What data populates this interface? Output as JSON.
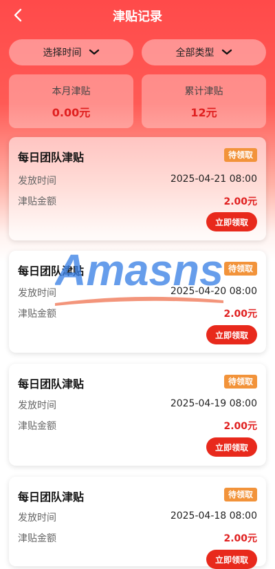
{
  "header": {
    "title": "津贴记录"
  },
  "filters": {
    "time_label": "选择时间",
    "type_label": "全部类型"
  },
  "stats": {
    "this_month_label": "本月津贴",
    "this_month_value": "0.00元",
    "total_label": "累计津贴",
    "total_value": "12元"
  },
  "record_labels": {
    "time_key": "发放时间",
    "amount_key": "津贴金额"
  },
  "records": [
    {
      "title": "每日团队津贴",
      "status": "待领取",
      "time": "2025-04-21 08:00",
      "amount": "2.00元",
      "action": "立即领取"
    },
    {
      "title": "每日团队津贴",
      "status": "待领取",
      "time": "2025-04-20 08:00",
      "amount": "2.00元",
      "action": "立即领取"
    },
    {
      "title": "每日团队津贴",
      "status": "待领取",
      "time": "2025-04-19 08:00",
      "amount": "2.00元",
      "action": "立即领取"
    },
    {
      "title": "每日团队津贴",
      "status": "待领取",
      "time": "2025-04-18 08:00",
      "amount": "2.00元",
      "action": "立即领取"
    }
  ],
  "watermark": {
    "text": "Amasns"
  },
  "colors": {
    "accent": "#e8291c",
    "badge": "#f2933a",
    "money": "#e02020",
    "header_bg": "#ff4a4a"
  },
  "icons": {
    "back": "chevron-left-icon",
    "dropdown": "chevron-down-icon"
  }
}
